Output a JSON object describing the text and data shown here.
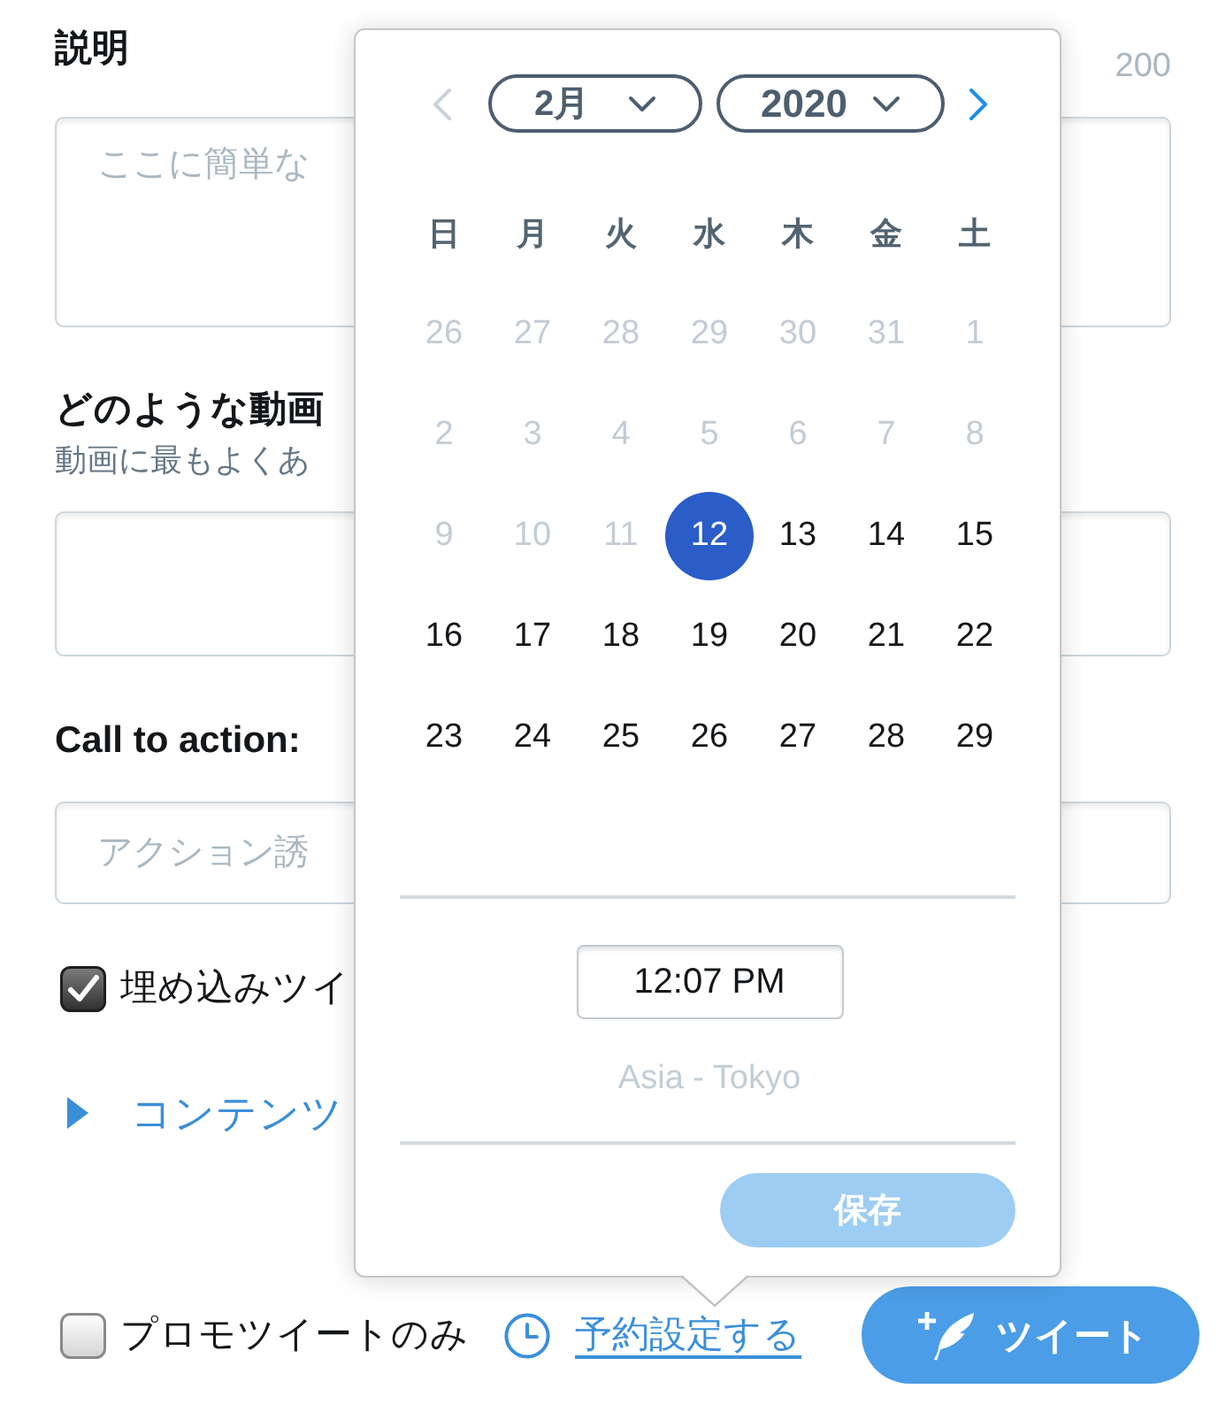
{
  "description": {
    "label": "説明",
    "counter": "200",
    "placeholder": "ここに簡単な"
  },
  "video_type": {
    "label": "どのような動画",
    "hint": "動画に最もよくあ"
  },
  "call_to_action": {
    "label": "Call to action:",
    "placeholder": "アクション誘"
  },
  "embed_option": {
    "label": "埋め込みツイ",
    "checked": true
  },
  "content_section": {
    "label": "コンテンツ",
    "expanded": false
  },
  "footer": {
    "promo_only": {
      "label": "プロモツイートのみ",
      "checked": false
    },
    "schedule_link": "予約設定する",
    "tweet_button": "ツイート"
  },
  "date_picker": {
    "prev": {
      "disabled": true
    },
    "month": "2月",
    "year": "2020",
    "next": {
      "disabled": false
    },
    "weekdays": [
      "日",
      "月",
      "火",
      "水",
      "木",
      "金",
      "土"
    ],
    "weeks": [
      [
        {
          "day": "26",
          "muted": true,
          "selected": false
        },
        {
          "day": "27",
          "muted": true,
          "selected": false
        },
        {
          "day": "28",
          "muted": true,
          "selected": false
        },
        {
          "day": "29",
          "muted": true,
          "selected": false
        },
        {
          "day": "30",
          "muted": true,
          "selected": false
        },
        {
          "day": "31",
          "muted": true,
          "selected": false
        },
        {
          "day": "1",
          "muted": true,
          "selected": false
        }
      ],
      [
        {
          "day": "2",
          "muted": true,
          "selected": false
        },
        {
          "day": "3",
          "muted": true,
          "selected": false
        },
        {
          "day": "4",
          "muted": true,
          "selected": false
        },
        {
          "day": "5",
          "muted": true,
          "selected": false
        },
        {
          "day": "6",
          "muted": true,
          "selected": false
        },
        {
          "day": "7",
          "muted": true,
          "selected": false
        },
        {
          "day": "8",
          "muted": true,
          "selected": false
        }
      ],
      [
        {
          "day": "9",
          "muted": true,
          "selected": false
        },
        {
          "day": "10",
          "muted": true,
          "selected": false
        },
        {
          "day": "11",
          "muted": true,
          "selected": false
        },
        {
          "day": "12",
          "muted": false,
          "selected": true
        },
        {
          "day": "13",
          "muted": false,
          "selected": false
        },
        {
          "day": "14",
          "muted": false,
          "selected": false
        },
        {
          "day": "15",
          "muted": false,
          "selected": false
        }
      ],
      [
        {
          "day": "16",
          "muted": false,
          "selected": false
        },
        {
          "day": "17",
          "muted": false,
          "selected": false
        },
        {
          "day": "18",
          "muted": false,
          "selected": false
        },
        {
          "day": "19",
          "muted": false,
          "selected": false
        },
        {
          "day": "20",
          "muted": false,
          "selected": false
        },
        {
          "day": "21",
          "muted": false,
          "selected": false
        },
        {
          "day": "22",
          "muted": false,
          "selected": false
        }
      ],
      [
        {
          "day": "23",
          "muted": false,
          "selected": false
        },
        {
          "day": "24",
          "muted": false,
          "selected": false
        },
        {
          "day": "25",
          "muted": false,
          "selected": false
        },
        {
          "day": "26",
          "muted": false,
          "selected": false
        },
        {
          "day": "27",
          "muted": false,
          "selected": false
        },
        {
          "day": "28",
          "muted": false,
          "selected": false
        },
        {
          "day": "29",
          "muted": false,
          "selected": false
        }
      ]
    ],
    "time": "12:07 PM",
    "timezone": "Asia - Tokyo",
    "save_button": {
      "label": "保存",
      "disabled": true
    }
  }
}
